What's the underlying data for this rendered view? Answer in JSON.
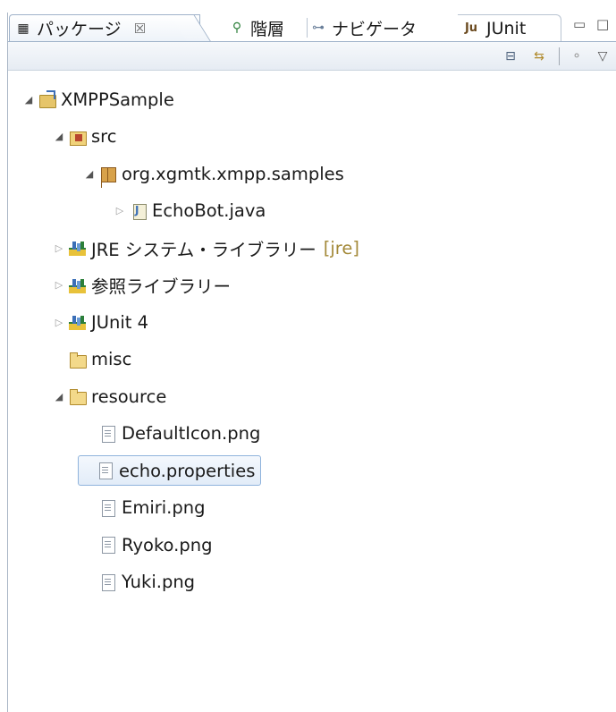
{
  "tabs": {
    "package": {
      "icon": "package-explorer-icon",
      "label": "パッケージ",
      "close": "☒"
    },
    "hierarchy": {
      "icon": "hierarchy-icon",
      "label": "階層"
    },
    "navigator": {
      "icon": "navigator-icon",
      "label": "ナビゲータ"
    },
    "junit": {
      "icon": "junit-icon",
      "label": "JUnit"
    }
  },
  "window_controls": {
    "minimize": "▭",
    "maximize": "□"
  },
  "toolbar": {
    "collapse_all": "⊟",
    "link_editor": "⇆",
    "focus": "⚬",
    "view_menu": "▽"
  },
  "tree": [
    {
      "depth": 0,
      "twisty": "◢",
      "icon": "project",
      "label": "XMPPSample"
    },
    {
      "depth": 1,
      "twisty": "◢",
      "icon": "srcfolder",
      "label": "src"
    },
    {
      "depth": 2,
      "twisty": "◢",
      "icon": "package",
      "label": "org.xgmtk.xmpp.samples"
    },
    {
      "depth": 3,
      "twisty": "▷",
      "icon": "java",
      "label": "EchoBot.java"
    },
    {
      "depth": 1,
      "twisty": "▷",
      "icon": "library",
      "label": "JRE システム・ライブラリー",
      "suffix": "[jre]"
    },
    {
      "depth": 1,
      "twisty": "▷",
      "icon": "library",
      "label": "参照ライブラリー"
    },
    {
      "depth": 1,
      "twisty": "▷",
      "icon": "library",
      "label": "JUnit 4"
    },
    {
      "depth": 1,
      "twisty": "",
      "icon": "folder",
      "label": "misc"
    },
    {
      "depth": 1,
      "twisty": "◢",
      "icon": "folder",
      "label": "resource"
    },
    {
      "depth": 2,
      "twisty": "",
      "icon": "file",
      "label": "DefaultIcon.png"
    },
    {
      "depth": 2,
      "twisty": "",
      "icon": "file",
      "label": "echo.properties",
      "selected": true
    },
    {
      "depth": 2,
      "twisty": "",
      "icon": "file",
      "label": "Emiri.png"
    },
    {
      "depth": 2,
      "twisty": "",
      "icon": "file",
      "label": "Ryoko.png"
    },
    {
      "depth": 2,
      "twisty": "",
      "icon": "file",
      "label": "Yuki.png"
    }
  ]
}
